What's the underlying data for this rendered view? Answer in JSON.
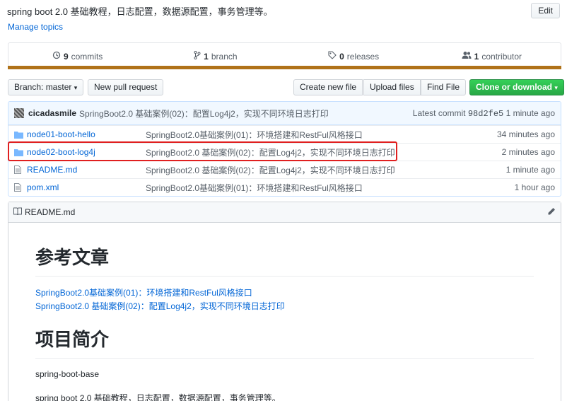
{
  "repo": {
    "description": "spring boot 2.0 基础教程，日志配置，数据源配置，事务管理等。",
    "manage_topics": "Manage topics",
    "edit_label": "Edit"
  },
  "summary": {
    "commits_count": "9",
    "commits_label": "commits",
    "branch_count": "1",
    "branch_label": "branch",
    "releases_count": "0",
    "releases_label": "releases",
    "contributor_count": "1",
    "contributor_label": "contributor",
    "language_color": "#b07219"
  },
  "toolbar": {
    "branch_label": "Branch: master",
    "new_pull_request": "New pull request",
    "create_new_file": "Create new file",
    "upload_files": "Upload files",
    "find_file": "Find File",
    "clone_or_download": "Clone or download"
  },
  "latest_commit": {
    "author": "cicadasmile",
    "message": "SpringBoot2.0 基础案例(02)：配置Log4j2，实现不同环境日志打印",
    "prefix": "Latest commit",
    "sha": "98d2fe5",
    "age": "1 minute ago"
  },
  "files": [
    {
      "type": "dir",
      "name": "node01-boot-hello",
      "message": "SpringBoot2.0基础案例(01)：环境搭建和RestFul风格接口",
      "age": "34 minutes ago"
    },
    {
      "type": "dir",
      "name": "node02-boot-log4j",
      "message": "SpringBoot2.0 基础案例(02)：配置Log4j2，实现不同环境日志打印",
      "age": "2 minutes ago"
    },
    {
      "type": "file",
      "name": "README.md",
      "message": "SpringBoot2.0 基础案例(02)：配置Log4j2，实现不同环境日志打印",
      "age": "1 minute ago"
    },
    {
      "type": "file",
      "name": "pom.xml",
      "message": "SpringBoot2.0基础案例(01)：环境搭建和RestFul风格接口",
      "age": "1 hour ago"
    }
  ],
  "readme": {
    "filename": "README.md",
    "heading1": "参考文章",
    "link1": "SpringBoot2.0基础案例(01)：环境搭建和RestFul风格接口",
    "link2": "SpringBoot2.0 基础案例(02)：配置Log4j2，实现不同环境日志打印",
    "heading2": "项目简介",
    "para1": "spring-boot-base",
    "para2": "spring boot 2.0 基础教程，日志配置，数据源配置，事务管理等。"
  }
}
